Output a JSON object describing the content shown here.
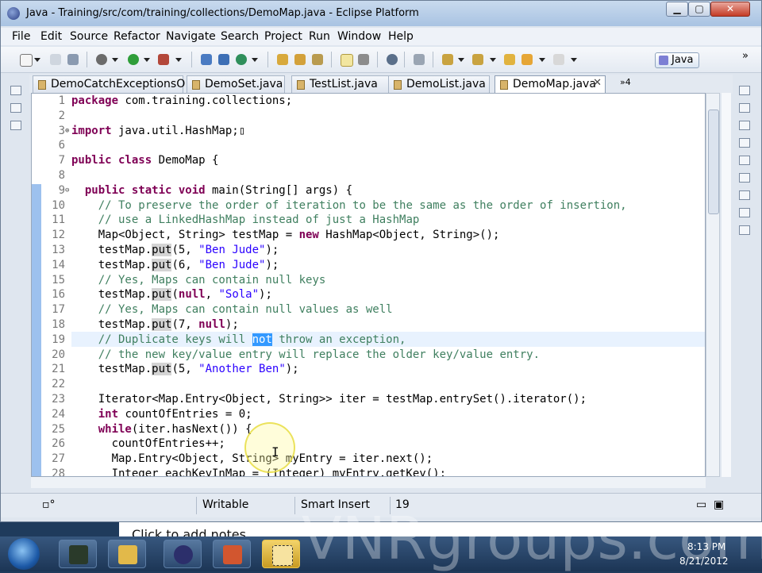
{
  "window": {
    "title": "Java - Training/src/com/training/collections/DemoMap.java - Eclipse Platform"
  },
  "menu": [
    "File",
    "Edit",
    "Source",
    "Refactor",
    "Navigate",
    "Search",
    "Project",
    "Run",
    "Window",
    "Help"
  ],
  "perspective": {
    "label": "Java"
  },
  "tabs": [
    {
      "label": "DemoCatchExceptionsO",
      "active": false
    },
    {
      "label": "DemoSet.java",
      "active": false
    },
    {
      "label": "TestList.java",
      "active": false
    },
    {
      "label": "DemoList.java",
      "active": false
    },
    {
      "label": "DemoMap.java",
      "active": true
    }
  ],
  "tab_overflow": "»4",
  "code": [
    {
      "n": "1",
      "t": "<span class='kw'>package</span> com.training.collections;"
    },
    {
      "n": "2",
      "t": ""
    },
    {
      "n": "3",
      "t": "<span class='kw'>import</span> java.util.HashMap;▯",
      "fold": "⊕"
    },
    {
      "n": "6",
      "t": ""
    },
    {
      "n": "7",
      "t": "<span class='kw'>public class</span> DemoMap {"
    },
    {
      "n": "8",
      "t": ""
    },
    {
      "n": "9",
      "t": "  <span class='kw'>public static void</span> main(String[] args) {",
      "fold": "⊖"
    },
    {
      "n": "10",
      "t": "    <span class='cmt'>// To preserve the order of iteration to be the same as the order of insertion,</span>"
    },
    {
      "n": "11",
      "t": "    <span class='cmt'>// use a LinkedHashMap instead of just a HashMap</span>"
    },
    {
      "n": "12",
      "t": "    Map&lt;Object, String&gt; testMap = <span class='kw'>new</span> HashMap&lt;Object, String&gt;();"
    },
    {
      "n": "13",
      "t": "    testMap.<span class='put'>put</span>(5, <span class='str'>\"Ben Jude\"</span>);"
    },
    {
      "n": "14",
      "t": "    testMap.<span class='put'>put</span>(6, <span class='str'>\"Ben Jude\"</span>);"
    },
    {
      "n": "15",
      "t": "    <span class='cmt'>// Yes, Maps can contain null keys</span>"
    },
    {
      "n": "16",
      "t": "    testMap.<span class='put'>put</span>(<span class='kw'>null</span>, <span class='str'>\"Sola\"</span>);"
    },
    {
      "n": "17",
      "t": "    <span class='cmt'>// Yes, Maps can contain null values as well</span>"
    },
    {
      "n": "18",
      "t": "    testMap.<span class='put'>put</span>(7, <span class='kw'>null</span>);"
    },
    {
      "n": "19",
      "t": "    <span class='cmt'>// Duplicate keys will <span class='sel'>not</span> throw an exception,</span>"
    },
    {
      "n": "20",
      "t": "    <span class='cmt'>// the new key/value entry will replace the older key/value entry.</span>"
    },
    {
      "n": "21",
      "t": "    testMap.<span class='put'>put</span>(5, <span class='str'>\"Another Ben\"</span>);"
    },
    {
      "n": "22",
      "t": ""
    },
    {
      "n": "23",
      "t": "    Iterator&lt;Map.Entry&lt;Object, String&gt;&gt; iter = testMap.entrySet().iterator();"
    },
    {
      "n": "24",
      "t": "    <span class='kw'>int</span> countOfEntries = 0;"
    },
    {
      "n": "25",
      "t": "    <span class='kw'>while</span>(iter.hasNext()) {"
    },
    {
      "n": "26",
      "t": "      countOfEntries++;"
    },
    {
      "n": "27",
      "t": "      Map.Entry&lt;Object, String&gt; myEntry = iter.next();"
    },
    {
      "n": "28",
      "t": "      Integer eachKeyInMap = (Integer) myEntry.getKey();"
    }
  ],
  "status": {
    "writable": "Writable",
    "insert_mode": "Smart Insert",
    "position": "19"
  },
  "notes": "Click to add notes",
  "clock": {
    "time": "8:13 PM",
    "date": "8/21/2012"
  },
  "watermark": "VNRgroups.com"
}
